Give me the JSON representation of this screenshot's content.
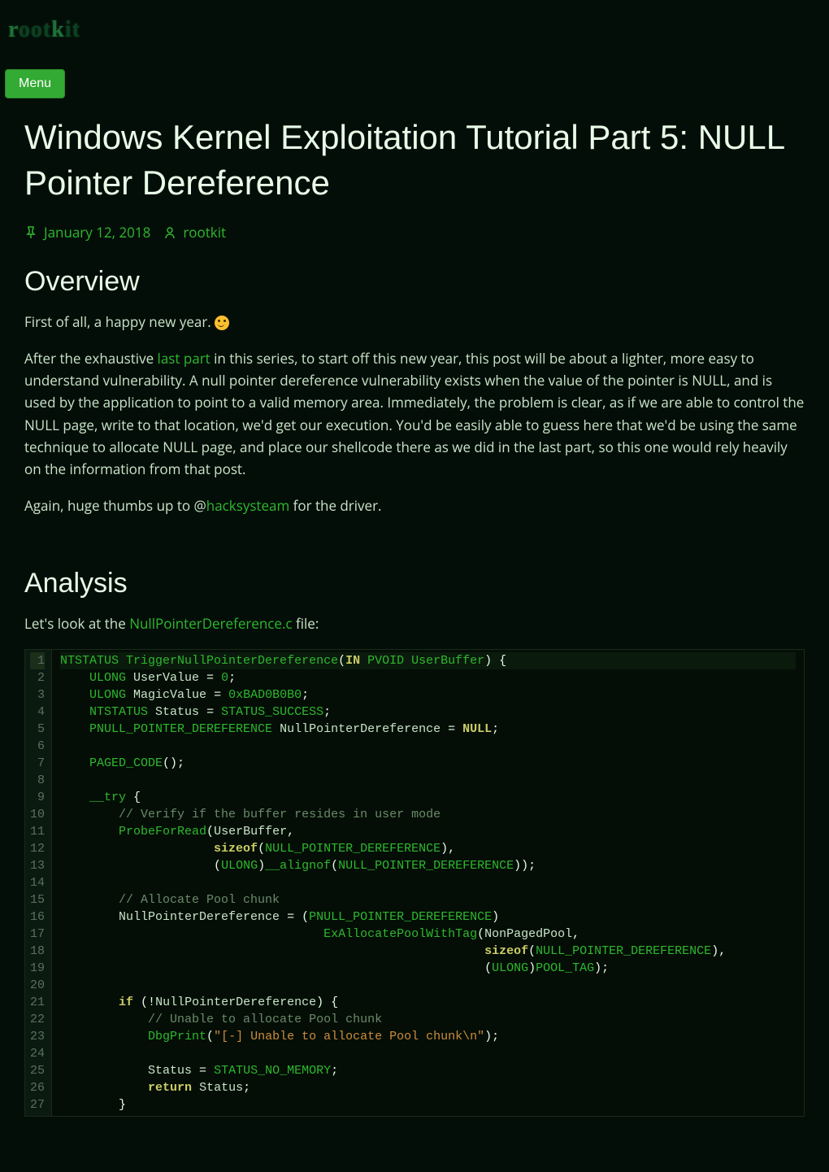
{
  "site": {
    "logo_text": "rootkit"
  },
  "nav": {
    "menu_label": "Menu"
  },
  "post": {
    "title": "Windows Kernel Exploitation Tutorial Part 5: NULL Pointer Dereference",
    "date": "January 12, 2018",
    "author": "rootkit",
    "sections": {
      "overview": {
        "heading": "Overview"
      },
      "analysis": {
        "heading": "Analysis"
      }
    },
    "paragraphs": {
      "p1_prefix": "First of all, a happy new year. ",
      "p2_a": "After the exhaustive ",
      "p2_link": "last part",
      "p2_b": " in this series, to start off this new year, this post will be about a lighter, more easy to understand vulnerability. A null pointer dereference vulnerability exists when the value of the pointer is NULL, and is used by the application to point to a valid memory area. Immediately, the problem is clear, as if we are able to control the NULL page, write to that location, we'd get our execution. You'd be easily able to guess here that we'd be using the same technique to allocate NULL page, and place our shellcode there as we did in the last part, so this one would rely heavily on the information from that post.",
      "p3_a": "Again, huge thumbs up to @",
      "p3_link": "hacksysteam",
      "p3_b": " for the driver.",
      "p4_a": "Let's look at the ",
      "p4_link": "NullPointerDereference.c",
      "p4_b": " file:"
    },
    "code": {
      "lines": [
        {
          "n": 1,
          "tokens": [
            [
              "NTSTATUS ",
              "type"
            ],
            [
              "TriggerNullPointerDereference",
              "func"
            ],
            [
              "(",
              "punct"
            ],
            [
              "IN",
              "kw"
            ],
            [
              " PVOID UserBuffer",
              "type"
            ],
            [
              ") {",
              "punct"
            ]
          ]
        },
        {
          "n": 2,
          "tokens": [
            [
              "    ULONG ",
              "type"
            ],
            [
              "UserValue ",
              "ident"
            ],
            [
              "= ",
              "op"
            ],
            [
              "0",
              "num"
            ],
            [
              ";",
              "punct"
            ]
          ]
        },
        {
          "n": 3,
          "tokens": [
            [
              "    ULONG ",
              "type"
            ],
            [
              "MagicValue ",
              "ident"
            ],
            [
              "= ",
              "op"
            ],
            [
              "0xBAD0B0B0",
              "num"
            ],
            [
              ";",
              "punct"
            ]
          ]
        },
        {
          "n": 4,
          "tokens": [
            [
              "    NTSTATUS ",
              "type"
            ],
            [
              "Status ",
              "ident"
            ],
            [
              "= ",
              "op"
            ],
            [
              "STATUS_SUCCESS",
              "type"
            ],
            [
              ";",
              "punct"
            ]
          ]
        },
        {
          "n": 5,
          "tokens": [
            [
              "    PNULL_POINTER_DEREFERENCE ",
              "type"
            ],
            [
              "NullPointerDereference ",
              "ident"
            ],
            [
              "= ",
              "op"
            ],
            [
              "NULL",
              "const"
            ],
            [
              ";",
              "punct"
            ]
          ]
        },
        {
          "n": 6,
          "tokens": [
            [
              " ",
              "ident"
            ]
          ]
        },
        {
          "n": 7,
          "tokens": [
            [
              "    PAGED_CODE",
              "type"
            ],
            [
              "();",
              "punct"
            ]
          ]
        },
        {
          "n": 8,
          "tokens": [
            [
              " ",
              "ident"
            ]
          ]
        },
        {
          "n": 9,
          "tokens": [
            [
              "    __try ",
              "type"
            ],
            [
              "{",
              "punct"
            ]
          ]
        },
        {
          "n": 10,
          "tokens": [
            [
              "        // Verify if the buffer resides in user mode",
              "comment"
            ]
          ]
        },
        {
          "n": 11,
          "tokens": [
            [
              "        ProbeForRead",
              "type"
            ],
            [
              "(",
              "punct"
            ],
            [
              "UserBuffer",
              "ident"
            ],
            [
              ",",
              "punct"
            ]
          ]
        },
        {
          "n": 12,
          "tokens": [
            [
              "                     ",
              "ident"
            ],
            [
              "sizeof",
              "kw"
            ],
            [
              "(",
              "punct"
            ],
            [
              "NULL_POINTER_DEREFERENCE",
              "type"
            ],
            [
              "),",
              "punct"
            ]
          ]
        },
        {
          "n": 13,
          "tokens": [
            [
              "                     (",
              "punct"
            ],
            [
              "ULONG",
              "type"
            ],
            [
              ")",
              "punct"
            ],
            [
              "__alignof",
              "type"
            ],
            [
              "(",
              "punct"
            ],
            [
              "NULL_POINTER_DEREFERENCE",
              "type"
            ],
            [
              "));",
              "punct"
            ]
          ]
        },
        {
          "n": 14,
          "tokens": [
            [
              " ",
              "ident"
            ]
          ]
        },
        {
          "n": 15,
          "tokens": [
            [
              "        // Allocate Pool chunk",
              "comment"
            ]
          ]
        },
        {
          "n": 16,
          "tokens": [
            [
              "        NullPointerDereference ",
              "ident"
            ],
            [
              "= (",
              "op"
            ],
            [
              "PNULL_POINTER_DEREFERENCE",
              "type"
            ],
            [
              ")",
              "punct"
            ]
          ]
        },
        {
          "n": 17,
          "tokens": [
            [
              "                                    ExAllocatePoolWithTag",
              "func"
            ],
            [
              "(",
              "punct"
            ],
            [
              "NonPagedPool",
              "ident"
            ],
            [
              ",",
              "punct"
            ]
          ]
        },
        {
          "n": 18,
          "tokens": [
            [
              "                                                          ",
              "ident"
            ],
            [
              "sizeof",
              "kw"
            ],
            [
              "(",
              "punct"
            ],
            [
              "NULL_POINTER_DEREFERENCE",
              "type"
            ],
            [
              "),",
              "punct"
            ]
          ]
        },
        {
          "n": 19,
          "tokens": [
            [
              "                                                          (",
              "punct"
            ],
            [
              "ULONG",
              "type"
            ],
            [
              ")",
              "punct"
            ],
            [
              "POOL_TAG",
              "type"
            ],
            [
              ");",
              "punct"
            ]
          ]
        },
        {
          "n": 20,
          "tokens": [
            [
              " ",
              "ident"
            ]
          ]
        },
        {
          "n": 21,
          "tokens": [
            [
              "        ",
              "ident"
            ],
            [
              "if",
              "kw"
            ],
            [
              " (!",
              "op"
            ],
            [
              "NullPointerDereference",
              "ident"
            ],
            [
              ") {",
              "punct"
            ]
          ]
        },
        {
          "n": 22,
          "tokens": [
            [
              "            // Unable to allocate Pool chunk",
              "comment"
            ]
          ]
        },
        {
          "n": 23,
          "tokens": [
            [
              "            DbgPrint",
              "type"
            ],
            [
              "(",
              "punct"
            ],
            [
              "\"[-] Unable to allocate Pool chunk\\n\"",
              "str"
            ],
            [
              ");",
              "punct"
            ]
          ]
        },
        {
          "n": 24,
          "tokens": [
            [
              " ",
              "ident"
            ]
          ]
        },
        {
          "n": 25,
          "tokens": [
            [
              "            Status ",
              "ident"
            ],
            [
              "= ",
              "op"
            ],
            [
              "STATUS_NO_MEMORY",
              "type"
            ],
            [
              ";",
              "punct"
            ]
          ]
        },
        {
          "n": 26,
          "tokens": [
            [
              "            ",
              "ident"
            ],
            [
              "return",
              "kw"
            ],
            [
              " Status",
              "ident"
            ],
            [
              ";",
              "punct"
            ]
          ]
        },
        {
          "n": 27,
          "tokens": [
            [
              "        }",
              "punct"
            ]
          ]
        }
      ]
    }
  }
}
